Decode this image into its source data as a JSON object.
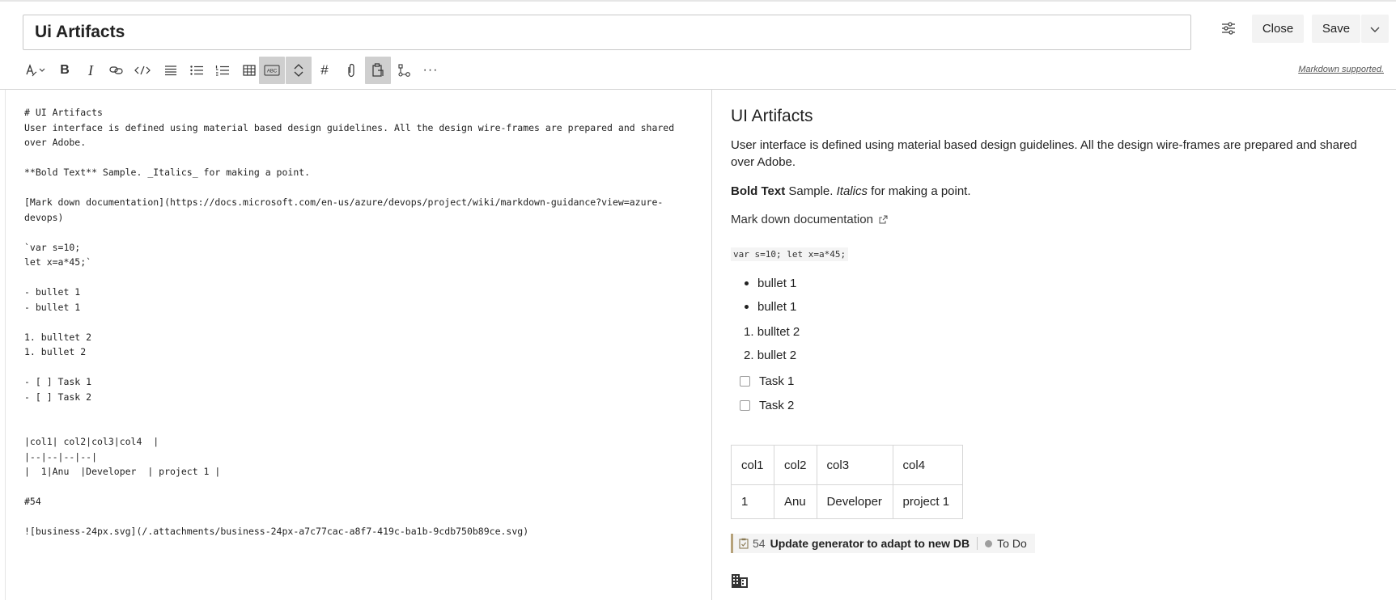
{
  "header": {
    "title_value": "Ui Artifacts",
    "close_label": "Close",
    "save_label": "Save"
  },
  "toolbar": {
    "items": [
      "format-icon",
      "bold-icon",
      "italic-icon",
      "link-icon",
      "code-icon",
      "quote-icon",
      "bulleted-list-icon",
      "numbered-list-icon",
      "table-icon",
      "spell-check-icon",
      "scroll-sync-icon",
      "work-item-icon",
      "attachment-icon",
      "paste-icon",
      "diagram-icon",
      "more-icon"
    ],
    "heading_glyph": "#",
    "bold_glyph": "B",
    "italic_glyph": "I",
    "more_glyph": "···",
    "markdown_link": "Markdown supported."
  },
  "editor": {
    "lines": [
      "# UI Artifacts",
      "User interface is defined using material based design guidelines. All the design wire-frames are prepared and shared",
      "over Adobe.",
      "",
      "**Bold Text** Sample. _Italics_ for making a point.",
      "",
      "[Mark down documentation](https://docs.microsoft.com/en-us/azure/devops/project/wiki/markdown-guidance?view=azure-",
      "devops)",
      "",
      "`var s=10;",
      "let x=a*45;`",
      "",
      "- bullet 1",
      "- bullet 1",
      "",
      "1. bulltet 2",
      "1. bullet 2",
      "",
      "- [ ] Task 1",
      "- [ ] Task 2",
      "",
      "",
      "|col1| col2|col3|col4  |",
      "|--|--|--|--|",
      "|  1|Anu  |Developer  | project 1 |",
      "",
      "#54",
      "",
      "![business-24px.svg](/.attachments/business-24px-a7c77cac-a8f7-419c-ba1b-9cdb750b89ce.svg)"
    ]
  },
  "preview": {
    "heading": "UI Artifacts",
    "paragraph": "User interface is defined using material based design guidelines. All the design wire-frames are prepared and shared over Adobe.",
    "bold_text": "Bold Text",
    "sample_text": " Sample. ",
    "italic_text": "Italics",
    "point_text": " for making a point.",
    "link_text": "Mark down documentation",
    "code_text": "var s=10; let x=a*45;",
    "bullets": [
      "bullet 1",
      "bullet 1"
    ],
    "numbered": [
      {
        "num": "1.",
        "text": "bulltet 2"
      },
      {
        "num": "2.",
        "text": "bullet 2"
      }
    ],
    "tasks": [
      "Task 1",
      "Task 2"
    ],
    "table": {
      "headers": [
        "col1",
        "col2",
        "col3",
        "col4"
      ],
      "rows": [
        [
          "1",
          "Anu",
          "Developer",
          "project 1"
        ]
      ]
    },
    "work_item": {
      "id": "54",
      "title": "Update generator to adapt to new DB",
      "state": "To Do"
    }
  },
  "colors": {
    "active_toolbar_bg": "#cfcfcf",
    "button_bg": "#f3f3f3",
    "work_item_bar": "#b6a27a",
    "state_dot": "#9e9e9e"
  }
}
